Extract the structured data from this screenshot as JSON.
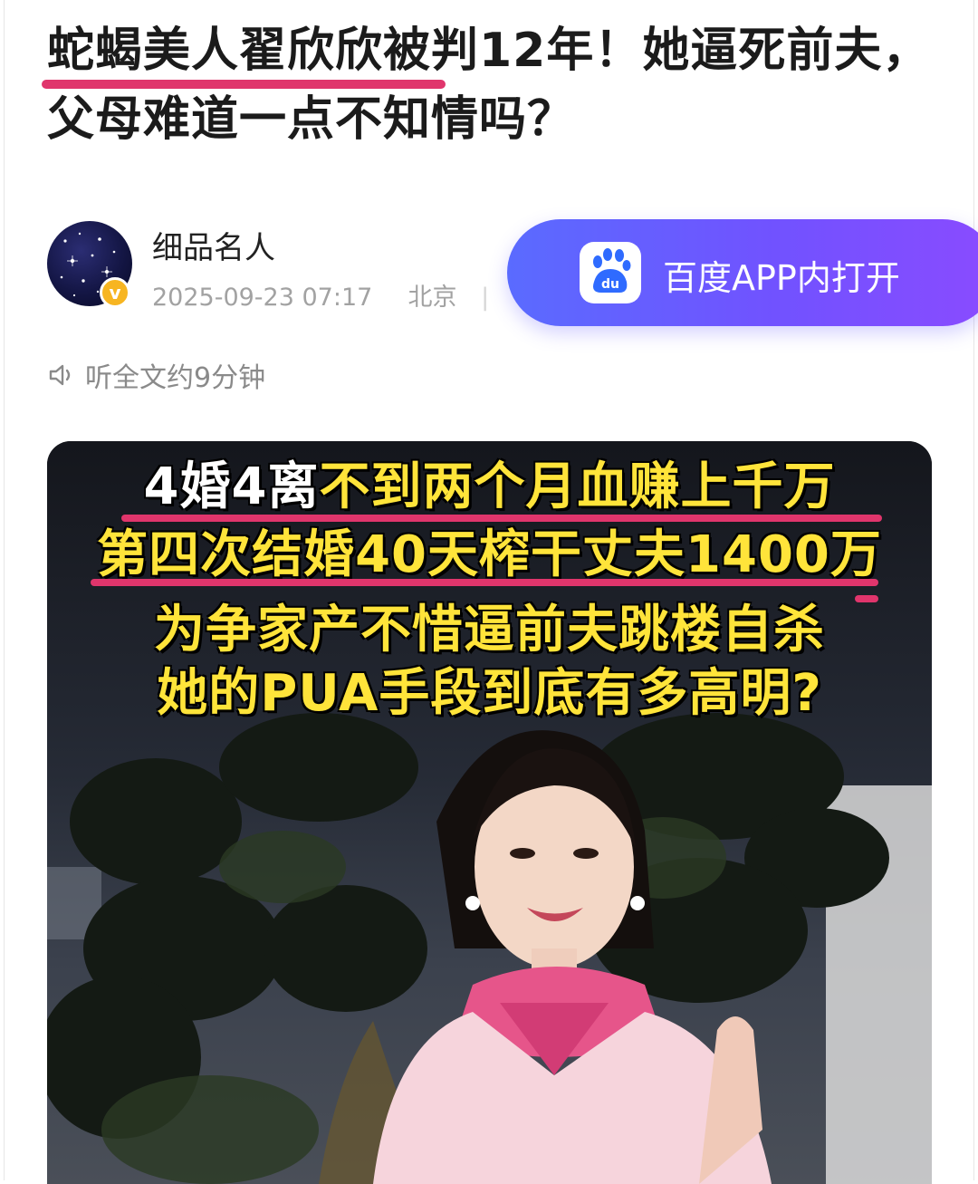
{
  "article": {
    "title": "蛇蝎美人翟欣欣被判12年！她逼死前夫，父母难道一点不知情吗？"
  },
  "author": {
    "name": "细品名人",
    "datetime": "2025-09-23 07:17",
    "location": "北京",
    "verified_icon": "verified-v-icon"
  },
  "app_banner": {
    "label": "百度APP内打开",
    "logo_text": "du",
    "gradient": [
      "#5a6bff",
      "#8a4bff"
    ]
  },
  "listen": {
    "icon": "speaker-icon",
    "label": "听全文约9分钟"
  },
  "hero_image": {
    "lines": [
      {
        "white": "4婚4离",
        "yellow": "不到两个月血赚上千万"
      },
      {
        "white": "",
        "yellow": "第四次结婚40天榨干丈夫1400万"
      },
      {
        "white": "",
        "yellow": "为争家产不惜逼前夫跳楼自杀"
      },
      {
        "white": "",
        "yellow": "她的PUA手段到底有多高明?"
      }
    ]
  },
  "colors": {
    "accent_pink": "#e0356c",
    "caption_yellow": "#ffe43a",
    "banner_purple": "#7152ff"
  }
}
